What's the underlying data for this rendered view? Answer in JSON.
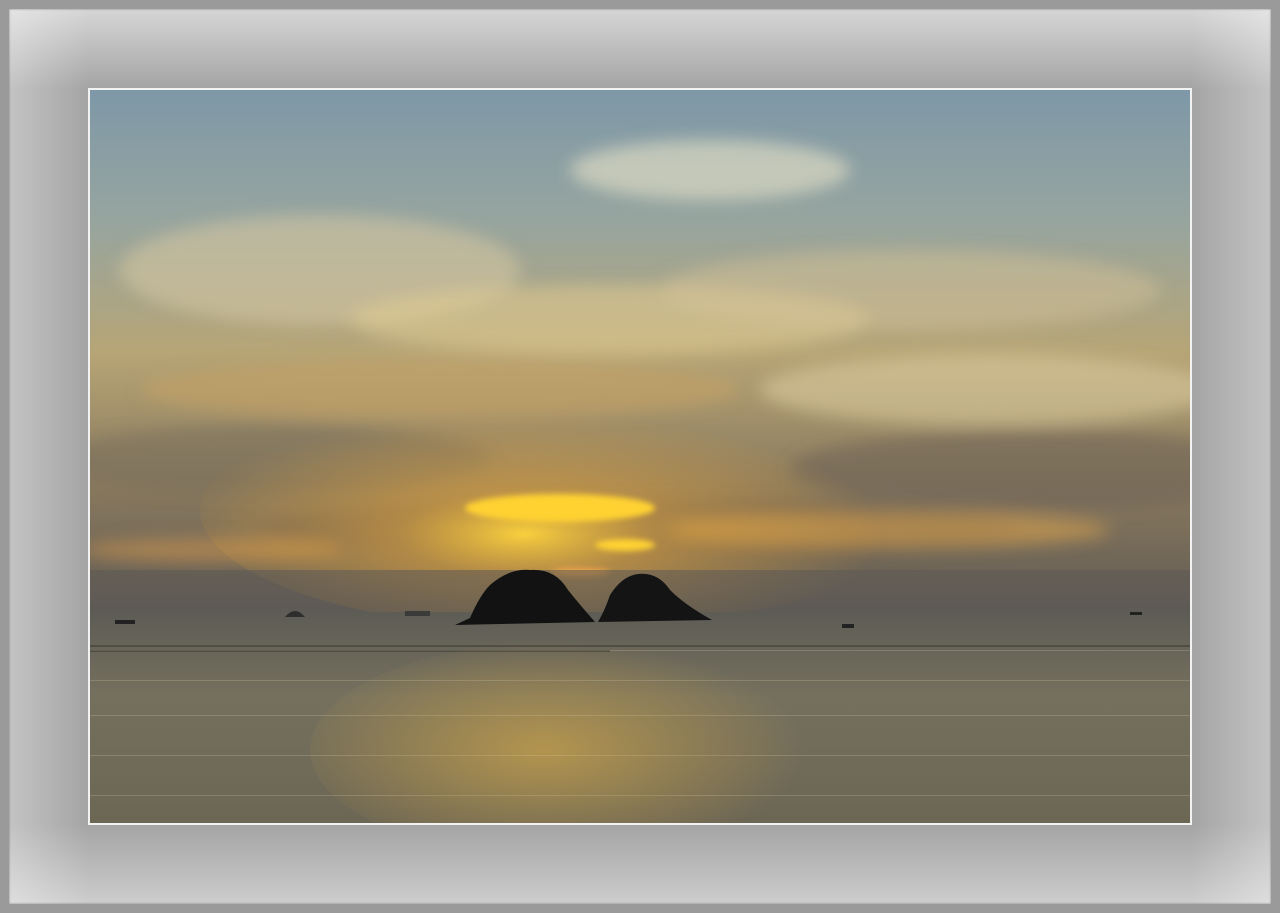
{
  "scene": {
    "subject": "sunset-over-sea-with-two-islets",
    "colors": {
      "mat": "#a4a4a4",
      "frame_edge": "#8f8f8f",
      "sky_blue": "#7d97a6",
      "sky_gold": "#e8b24a",
      "sun_glow": "#ffd23a",
      "sea": "#7a7460",
      "island": "#121212"
    }
  }
}
